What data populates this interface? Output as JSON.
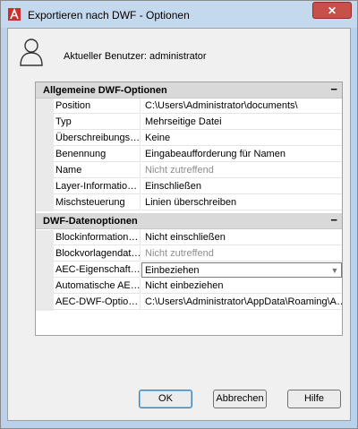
{
  "window": {
    "title": "Exportieren nach DWF - Optionen",
    "close_glyph": "✕",
    "app_icon": "autocad-logo"
  },
  "user": {
    "icon": "user-silhouette-icon",
    "label": "Aktueller Benutzer: administrator"
  },
  "categories": [
    {
      "title": "Allgemeine DWF-Optionen",
      "toggle": "−",
      "rows": [
        {
          "name": "Position",
          "value": "C:\\Users\\Administrator\\documents\\",
          "disabled": false
        },
        {
          "name": "Typ",
          "value": "Mehrseitige Datei",
          "disabled": false
        },
        {
          "name": "Überschreibungs…",
          "value": "Keine",
          "disabled": false
        },
        {
          "name": "Benennung",
          "value": "Eingabeaufforderung für Namen",
          "disabled": false
        },
        {
          "name": "Name",
          "value": "Nicht zutreffend",
          "disabled": true
        },
        {
          "name": "Layer-Informatio…",
          "value": "Einschließen",
          "disabled": false
        },
        {
          "name": "Mischsteuerung",
          "value": "Linien überschreiben",
          "disabled": false
        }
      ]
    },
    {
      "title": "DWF-Datenoptionen",
      "toggle": "−",
      "rows": [
        {
          "name": "Blockinformation…",
          "value": "Nicht einschließen",
          "disabled": false
        },
        {
          "name": "Blockvorlagendat…",
          "value": "Nicht zutreffend",
          "disabled": true
        },
        {
          "name": "AEC-Eigenschaft…",
          "value": "Einbeziehen",
          "disabled": false,
          "selected": true
        },
        {
          "name": "Automatische AE…",
          "value": "Nicht einbeziehen",
          "disabled": false
        },
        {
          "name": "AEC-DWF-Optio…",
          "value": "C:\\Users\\Administrator\\AppData\\Roaming\\A…",
          "disabled": false
        }
      ]
    }
  ],
  "buttons": {
    "ok": "OK",
    "cancel": "Abbrechen",
    "help": "Hilfe"
  },
  "colors": {
    "title_bar": "#c5d9ee",
    "close_button": "#c7504a",
    "category_header": "#d9d9d9",
    "disabled_text": "#8d8d8d"
  }
}
